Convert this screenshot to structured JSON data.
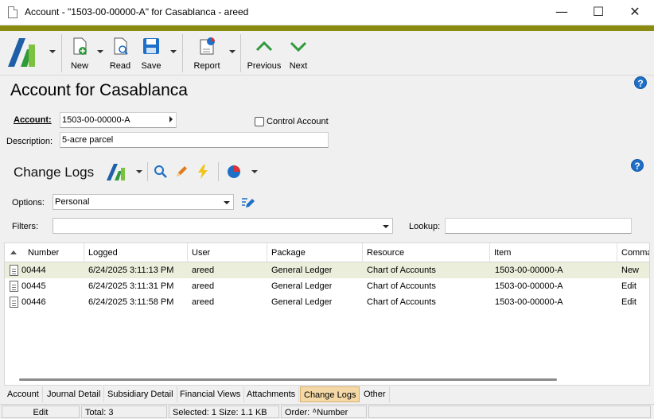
{
  "window": {
    "title": "Account - \"1503-00-00000-A\" for Casablanca - areed",
    "minimize": "—",
    "maximize": "☐",
    "close": "✕"
  },
  "toolbar": {
    "new_label": "New",
    "read_label": "Read",
    "save_label": "Save",
    "report_label": "Report",
    "previous_label": "Previous",
    "next_label": "Next"
  },
  "page": {
    "title": "Account for Casablanca",
    "account_label": "Account:",
    "account_value": "1503-00-00000-A",
    "control_account_label": "Control Account",
    "description_label": "Description:",
    "description_value": "5-acre parcel"
  },
  "change_logs": {
    "title": "Change Logs",
    "options_label": "Options:",
    "options_value": "Personal",
    "filters_label": "Filters:",
    "filters_value": "",
    "lookup_label": "Lookup:",
    "lookup_value": "",
    "columns": [
      "Number",
      "Logged",
      "User",
      "Package",
      "Resource",
      "Item",
      "Command"
    ],
    "rows": [
      {
        "number": "00444",
        "logged": "6/24/2025 3:11:13 PM",
        "user": "areed",
        "package": "General Ledger",
        "resource": "Chart of Accounts",
        "item": "1503-00-00000-A",
        "command": "New"
      },
      {
        "number": "00445",
        "logged": "6/24/2025 3:11:31 PM",
        "user": "areed",
        "package": "General Ledger",
        "resource": "Chart of Accounts",
        "item": "1503-00-00000-A",
        "command": "Edit"
      },
      {
        "number": "00446",
        "logged": "6/24/2025 3:11:58 PM",
        "user": "areed",
        "package": "General Ledger",
        "resource": "Chart of Accounts",
        "item": "1503-00-00000-A",
        "command": "Edit"
      }
    ]
  },
  "tabs": [
    "Account",
    "Journal Detail",
    "Subsidiary Detail",
    "Financial Views",
    "Attachments",
    "Change Logs",
    "Other"
  ],
  "active_tab": "Change Logs",
  "status": {
    "mode": "Edit",
    "total": "Total: 3",
    "selected": "Selected: 1  Size: 1.1 KB",
    "order": "Order: ᐞNumber"
  },
  "colors": {
    "accent": "#8a8a10",
    "selected_row": "#eaeedb",
    "active_tab": "#f4d9a6",
    "icon_blue": "#1e6fc7",
    "icon_green": "#2e9a3a"
  }
}
